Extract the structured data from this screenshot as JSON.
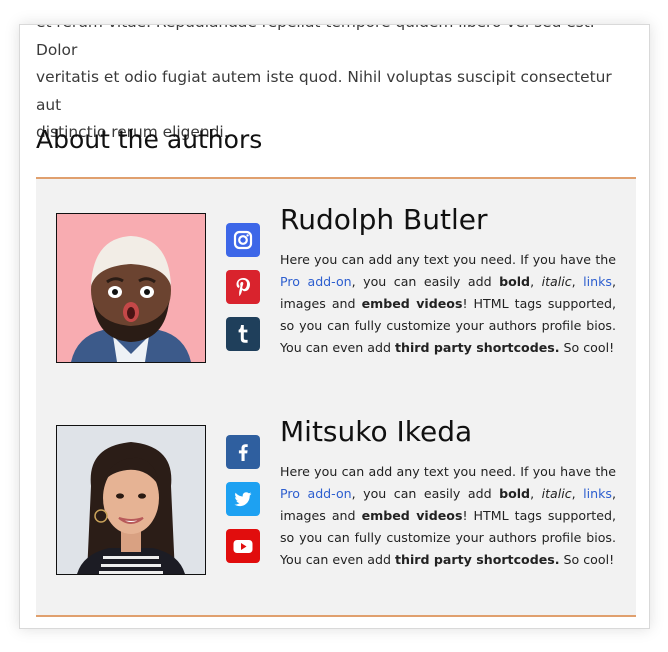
{
  "intro": {
    "line1": "et rerum vitae. Repudiandae repellat tempore quidem libero vel sed est. Dolor",
    "line2": "veritatis et odio fugiat autem iste quod. Nihil voluptas suscipit consectetur aut",
    "line3": "distinctio rerum eligendi."
  },
  "section_title": "About the authors",
  "colors": {
    "accent_border": "#e0a06e",
    "instagram": "#3d67e8",
    "pinterest": "#d9232d",
    "tumblr": "#1f3f5b",
    "facebook": "#2f5f9f",
    "twitter": "#1da1f2",
    "youtube": "#e10d0d",
    "link": "#2e5fcf"
  },
  "authors": [
    {
      "name": "Rudolph Butler",
      "photo_alt": "Rudolph Butler",
      "social": [
        "instagram-icon",
        "pinterest-icon",
        "tumblr-icon"
      ],
      "bio": {
        "t1": "Here you can add any text you need. If you have the ",
        "pro_link": "Pro add-on",
        "t2": ", you can easily add ",
        "bold": "bold",
        "sep1": ", ",
        "italic": "italic",
        "sep2": ", ",
        "links": "links",
        "t3": ", images and ",
        "embed": "embed videos",
        "t4": "! HTML tags supported, so you can fully customize your authors profile bios. You can even add ",
        "shortcodes": "third party shortcodes.",
        "t5": " So cool!"
      }
    },
    {
      "name": "Mitsuko Ikeda",
      "photo_alt": "Mitsuko Ikeda",
      "social": [
        "facebook-icon",
        "twitter-icon",
        "youtube-icon"
      ],
      "bio": {
        "t1": "Here you can add any text you need. If you have the ",
        "pro_link": "Pro add-on",
        "t2": ", you can easily add ",
        "bold": "bold",
        "sep1": ", ",
        "italic": "italic",
        "sep2": ", ",
        "links": "links",
        "t3": ", images and ",
        "embed": "embed videos",
        "t4": "! HTML tags supported, so you can fully customize your authors profile bios. You can even add ",
        "shortcodes": "third party shortcodes.",
        "t5": " So cool!"
      }
    }
  ]
}
